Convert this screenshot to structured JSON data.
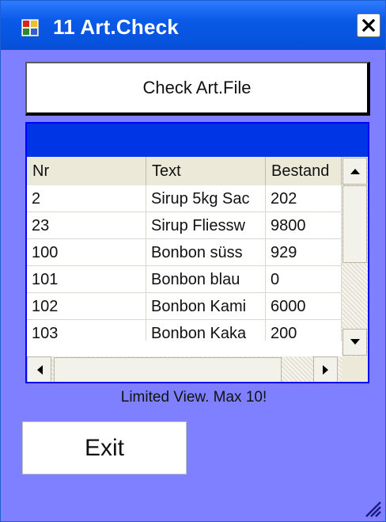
{
  "window": {
    "title": "11 Art.Check",
    "close_symbol": "×",
    "icon": "app-icon",
    "colors": {
      "titlebar": "#0a5ae8",
      "background": "#7f80ff",
      "grid_caption": "#0035e6"
    }
  },
  "check_button": {
    "label": "Check Art.File"
  },
  "grid": {
    "columns": [
      "Nr",
      "Text",
      "Bestand"
    ],
    "rows": [
      [
        "2",
        "Sirup 5kg Sac",
        "202"
      ],
      [
        "23",
        "Sirup Fliessw",
        "9800"
      ],
      [
        "100",
        "Bonbon süss",
        "929"
      ],
      [
        "101",
        "Bonbon blau",
        "0"
      ],
      [
        "102",
        "Bonbon Kami",
        "6000"
      ],
      [
        "103",
        "Bonbon Kaka",
        "200"
      ]
    ]
  },
  "limit_label": "Limited View. Max 10!",
  "exit_button": {
    "label": "Exit"
  }
}
